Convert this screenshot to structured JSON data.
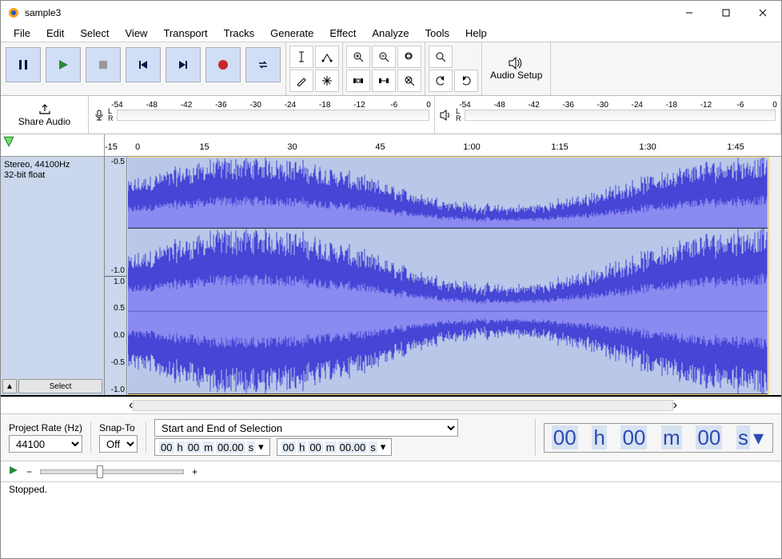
{
  "window": {
    "title": "sample3"
  },
  "menu": [
    "File",
    "Edit",
    "Select",
    "View",
    "Transport",
    "Tracks",
    "Generate",
    "Effect",
    "Analyze",
    "Tools",
    "Help"
  ],
  "meter_ticks": [
    "-54",
    "-48",
    "-42",
    "-36",
    "-30",
    "-24",
    "-18",
    "-12",
    "-6",
    "0"
  ],
  "timeline": [
    {
      "label": "-15",
      "pos": 0
    },
    {
      "label": "0",
      "pos": 4.5
    },
    {
      "label": "15",
      "pos": 14
    },
    {
      "label": "30",
      "pos": 27
    },
    {
      "label": "45",
      "pos": 40
    },
    {
      "label": "1:00",
      "pos": 53
    },
    {
      "label": "1:15",
      "pos": 66
    },
    {
      "label": "1:30",
      "pos": 79
    },
    {
      "label": "1:45",
      "pos": 92
    }
  ],
  "track": {
    "line1": "Stereo, 44100Hz",
    "line2": "32-bit float",
    "select": "Select"
  },
  "amp_ticks_top": [
    "-0.5",
    "-1.0"
  ],
  "amp_ticks_full": [
    "1.0",
    "0.5",
    "0.0",
    "-0.5",
    "-1.0"
  ],
  "share": "Share Audio",
  "audiosetup": "Audio Setup",
  "selection": {
    "projrate_label": "Project Rate (Hz)",
    "projrate_value": "44100",
    "snap_label": "Snap-To",
    "snap_value": "Off",
    "mode": "Start and End of Selection",
    "t1": "00 h 00 m 00.00 s",
    "t2": "00 h 00 m 00.00 s",
    "big": "00 h 00 m 00 s"
  },
  "playspeed": {
    "minus": "−",
    "plus": "+"
  },
  "status": "Stopped."
}
